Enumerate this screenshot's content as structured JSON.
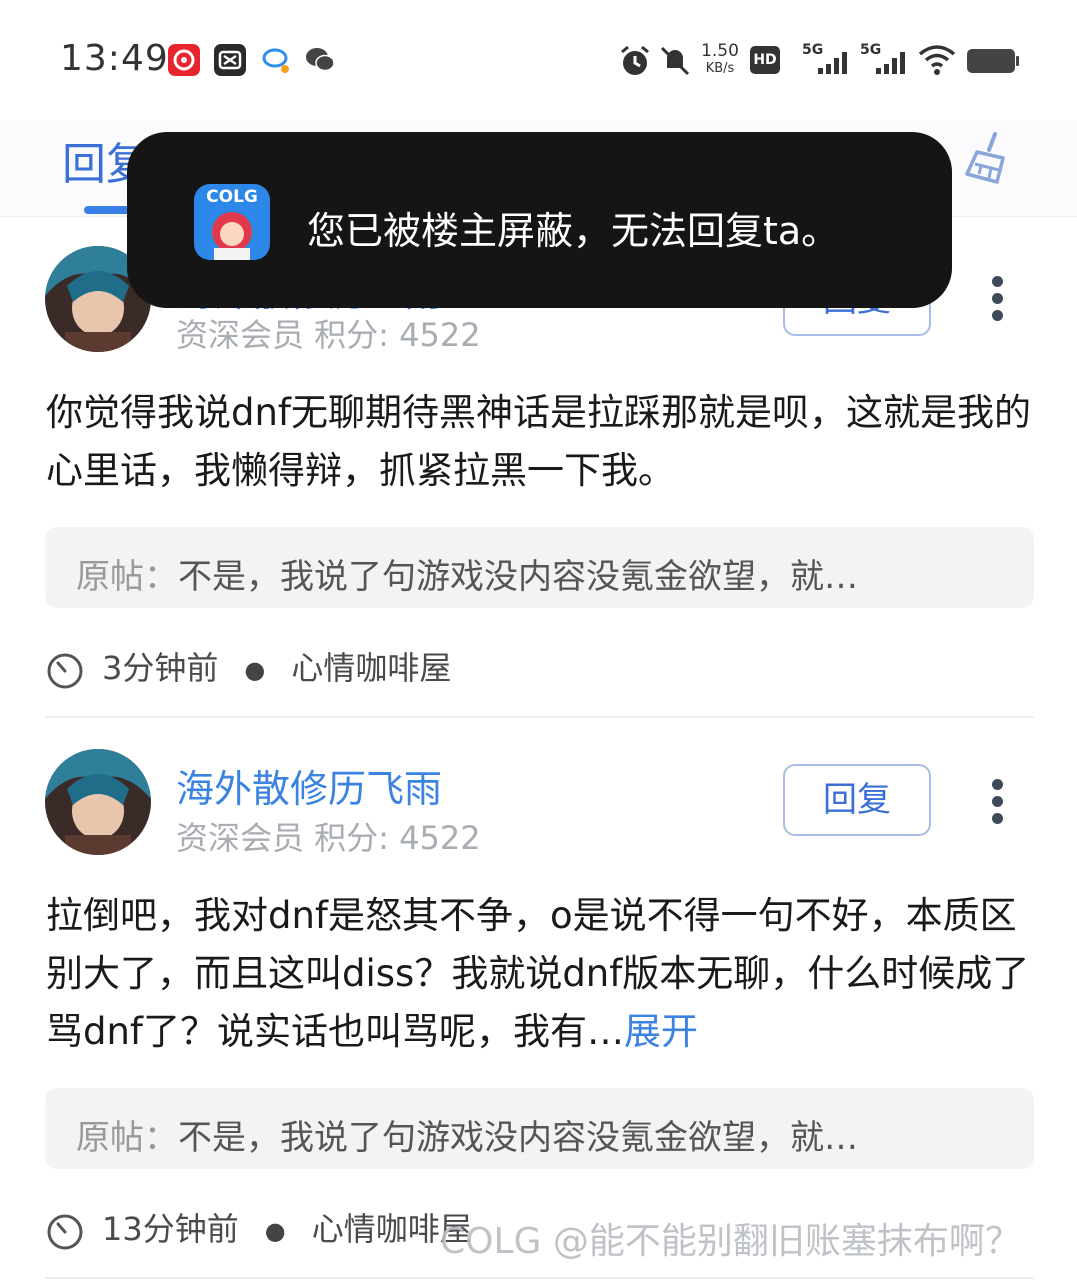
{
  "status_bar": {
    "time": "13:49",
    "network_speed_value": "1.50",
    "network_speed_unit": "KB/s",
    "hd_label": "HD",
    "sim1_label": "5G",
    "sim2_label": "5G",
    "icons": [
      "netease-music-icon",
      "capcut-icon",
      "chat-bubble-icon",
      "wechat-icon",
      "alarm-icon",
      "mute-icon",
      "wifi-icon",
      "battery-icon"
    ]
  },
  "tabs": {
    "active_label": "回复",
    "right_icon": "clean-broom-icon"
  },
  "toast": {
    "logo_text": "COLG",
    "message": "您已被楼主屏蔽，无法回复ta。"
  },
  "posts": [
    {
      "username": "海外散修历飞雨",
      "meta": "资深会员 积分: 4522",
      "reply_label": "回复",
      "content": "你觉得我说dnf无聊期待黑神话是拉踩那就是呗，这就是我的心里话，我懒得辩，抓紧拉黑一下我。",
      "quote_label": "原帖：",
      "quote_text": "不是，我说了句游戏没内容没氪金欲望，就…",
      "time": "3分钟前",
      "forum": "心情咖啡屋"
    },
    {
      "username": "海外散修历飞雨",
      "meta": "资深会员 积分: 4522",
      "reply_label": "回复",
      "content": "拉倒吧，我对dnf是怒其不争，o是说不得一句不好，本质区别大了，而且这叫diss？我就说dnf版本无聊，什么时候成了骂dnf了？说实话也叫骂呢，我有…",
      "expand_label": "展开",
      "quote_label": "原帖：",
      "quote_text": "不是，我说了句游戏没内容没氪金欲望，就…",
      "time": "13分钟前",
      "forum": "心情咖啡屋"
    }
  ],
  "watermark": "COLG @能不能别翻旧账塞抹布啊？",
  "colors": {
    "accent_blue": "#3b83e0",
    "toast_bg": "#151515",
    "quote_bg": "#f2f3f5"
  }
}
